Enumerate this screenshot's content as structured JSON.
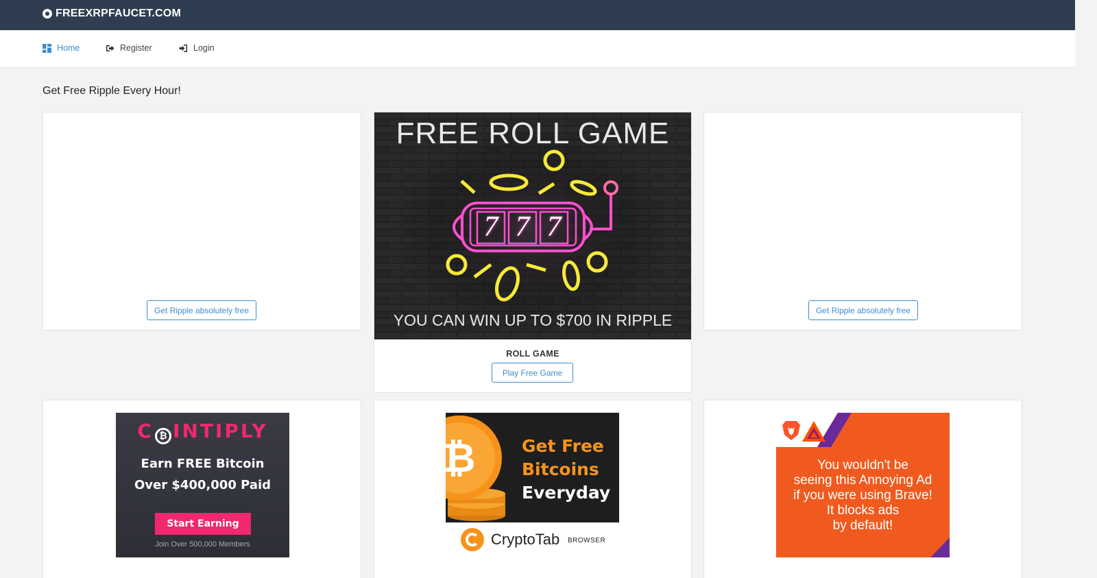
{
  "header": {
    "brand": "FREEXRPFAUCET.COM"
  },
  "nav": {
    "items": [
      {
        "label": "Home",
        "icon": "dashboard-icon",
        "active": true
      },
      {
        "label": "Register",
        "icon": "sign-out-icon"
      },
      {
        "label": "Login",
        "icon": "sign-in-icon"
      }
    ]
  },
  "main": {
    "title": "Get Free Ripple Every Hour!",
    "left_card": {
      "button": "Get Ripple absolutely free"
    },
    "center_card": {
      "banner_title": "FREE ROLL GAME",
      "banner_digits": [
        "7",
        "7",
        "7"
      ],
      "banner_caption": "YOU CAN WIN UP TO $700 IN RIPPLE",
      "label": "ROLL GAME",
      "button": "Play Free Game"
    },
    "right_card": {
      "button": "Get Ripple absolutely free"
    }
  },
  "ads": {
    "cointiply": {
      "logo_c": "C",
      "logo_rest": "INTIPLY",
      "line1": "Earn FREE Bitcoin",
      "line2": "Over $400,000 Paid",
      "button": "Start Earning",
      "footer": "Join Over 500,000 Members"
    },
    "cryptotab": {
      "line1": "Get Free",
      "line2": "Bitcoins",
      "line3": "Everyday",
      "brand": "CryptoTab",
      "brand_suffix": "BROWSER"
    },
    "brave": {
      "lines": [
        "You wouldn't be",
        "seeing this Annoying Ad",
        "if you were using Brave!",
        "It blocks ads",
        "by default!"
      ]
    }
  },
  "colors": {
    "topbar": "#2e3d50",
    "accent": "#3c8dcf",
    "cointiply_pink": "#f0286e",
    "cryptotab_orange": "#f7931a",
    "brave_orange": "#f05a1e"
  }
}
